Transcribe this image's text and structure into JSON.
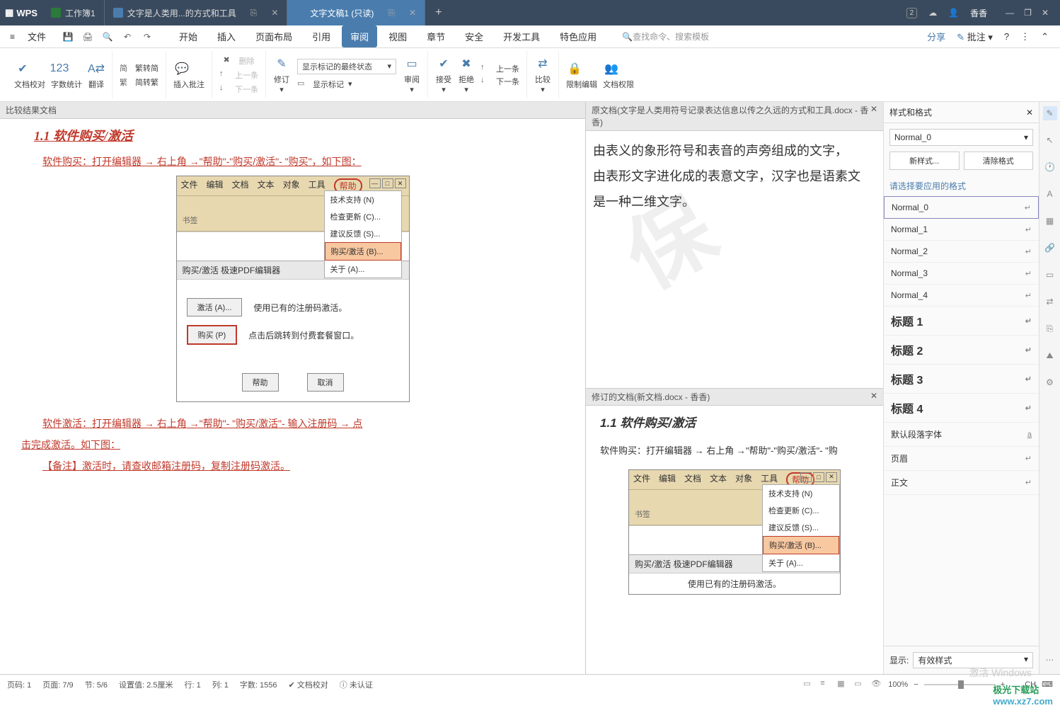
{
  "titlebar": {
    "app": "WPS",
    "tabs": [
      {
        "label": "工作簿1",
        "type": "s"
      },
      {
        "label": "文字是人类用...的方式和工具",
        "type": "w"
      },
      {
        "label": "文字文稿1 (只读)",
        "type": "w",
        "active": true
      }
    ],
    "user": "香香",
    "badge": "2"
  },
  "menu": {
    "file": "文件",
    "tabs": [
      "开始",
      "插入",
      "页面布局",
      "引用",
      "审阅",
      "视图",
      "章节",
      "安全",
      "开发工具",
      "特色应用"
    ],
    "active": "审阅",
    "search_icon": "🔍",
    "search_placeholder": "查找命令、搜索模板",
    "share": "分享",
    "pizhu": "批注"
  },
  "ribbon": {
    "g1": {
      "proof": "文档校对",
      "count": "字数统计",
      "trans": "翻译",
      "simp": "繁转简",
      "trad": "简转繁"
    },
    "g2": {
      "insert": "插入批注",
      "del": "删除",
      "prev": "上一条",
      "next": "下一条"
    },
    "g3": {
      "revise": "修订",
      "markup_select": "显示标记的最终状态",
      "show_markup": "显示标记",
      "pane": "审阅"
    },
    "g4": {
      "accept": "接受",
      "reject": "拒绝",
      "prev": "上一条",
      "next": "下一条"
    },
    "g5": {
      "compare": "比较"
    },
    "g6": {
      "restrict": "限制编辑",
      "perm": "文档权限"
    }
  },
  "leftpanel": {
    "title": "比较结果文档",
    "h3": "1.1 软件购买/激活",
    "buy_line": "软件购买：打开编辑器  →  右上角  →\"帮助\"-\"购买/激活\"- \"购买\"，如下图：",
    "act_line": "软件激活：打开编辑器  →  右上角  →\"帮助\"- \"购买/激活\"-  输入注册码  →  点",
    "act_line2": "击完成激活。如下图：",
    "note": "【备注】激活时，请查收邮箱注册码，复制注册码激活。"
  },
  "mockdialog": {
    "menu": [
      "文件",
      "编辑",
      "文档",
      "文本",
      "对象",
      "工具"
    ],
    "help": "帮助",
    "bookmark": "书签",
    "dropdown": [
      "技术支持 (N)",
      "检查更新 (C)...",
      "建议反馈 (S)...",
      "购买/激活 (B)...",
      "关于 (A)..."
    ],
    "title": "购买/激活 极速PDF编辑器",
    "act_text": "使用已有的注册码激活。",
    "act_btn": "激活 (A)...",
    "buy_text": "点击后跳转到付费套餐窗口。",
    "buy_btn": "购买 (P)",
    "help_btn": "帮助",
    "cancel_btn": "取消"
  },
  "rightTop": {
    "title": "原文档(文字是人类用符号记录表达信息以传之久远的方式和工具.docx - 香香)",
    "line1": "由表义的象形符号和表音的声旁组成的文字，",
    "line2": "由表形文字进化成的表意文字，汉字也是语素文",
    "line3": "是一种二维文字。"
  },
  "rightBottom": {
    "title": "修订的文档(新文档.docx - 香香)",
    "h4": "1.1 软件购买/激活",
    "line": "软件购买：打开编辑器  →  右上角  →\"帮助\"-\"购买/激活\"- \"购",
    "dd": [
      "技术支持 (N)",
      "检查更新 (C)...",
      "建议反馈 (S)...",
      "购买/激活 (B)...",
      "关于 (A)..."
    ],
    "act_text_crop": "使用已有的注册码激活。"
  },
  "stylepanel": {
    "title": "样式和格式",
    "current": "Normal_0",
    "new_btn": "新样式...",
    "clear_btn": "清除格式",
    "hint": "请选择要应用的格式",
    "items": [
      {
        "label": "Normal_0",
        "cls": "first"
      },
      {
        "label": "Normal_1"
      },
      {
        "label": "Normal_2"
      },
      {
        "label": "Normal_3"
      },
      {
        "label": "Normal_4"
      },
      {
        "label": "标题 1",
        "cls": "h"
      },
      {
        "label": "标题 2",
        "cls": "h"
      },
      {
        "label": "标题 3",
        "cls": "h"
      },
      {
        "label": "标题 4",
        "cls": "h"
      },
      {
        "label": "默认段落字体"
      },
      {
        "label": "页眉"
      },
      {
        "label": "正文"
      }
    ],
    "display_label": "显示:",
    "display_value": "有效样式"
  },
  "statusbar": {
    "page_num": "页码: 1",
    "page": "页面: 7/9",
    "sec": "节: 5/6",
    "indent": "设置值: 2.5厘米",
    "row": "行: 1",
    "col": "列: 1",
    "words": "字数: 1556",
    "proof": "文档校对",
    "unauth": "未认证",
    "zoom": "100%",
    "ch": "CH"
  },
  "activate": {
    "l1": "激活 Windows"
  },
  "jiguang": {
    "name": "极光下载站",
    "url": "www.xz7.com"
  }
}
